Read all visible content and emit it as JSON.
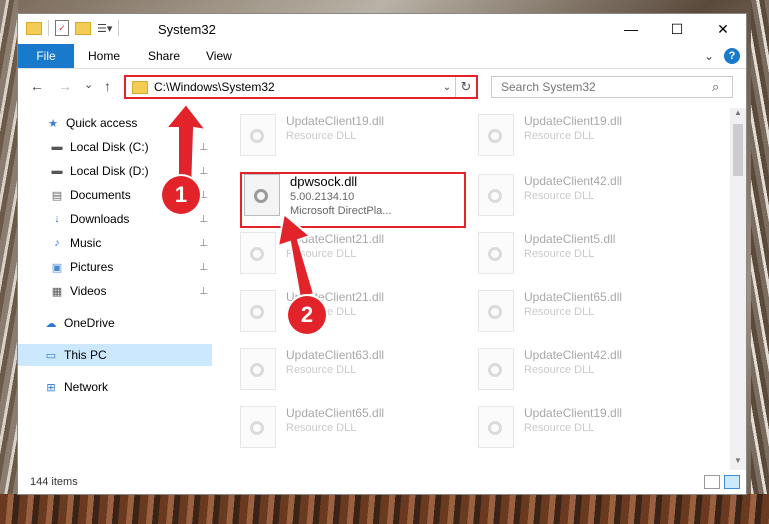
{
  "window": {
    "title": "System32",
    "controls": {
      "minimize": "—",
      "maximize": "☐",
      "close": "✕"
    }
  },
  "ribbon": {
    "tabs": [
      "File",
      "Home",
      "Share",
      "View"
    ],
    "expand_glyph": "⌄",
    "help_glyph": "?"
  },
  "nav": {
    "back": "←",
    "forward": "→",
    "recent": "⌄",
    "up": "↑",
    "address": "C:\\Windows\\System32",
    "dropdown": "⌄",
    "refresh": "↻",
    "search_placeholder": "Search System32",
    "search_glyph": "⌕"
  },
  "sidebar": {
    "items": [
      {
        "label": "Quick access",
        "icon": "star-icon",
        "glyph": "★",
        "color": "#3a7fd5"
      },
      {
        "label": "Local Disk (C:)",
        "icon": "drive-icon",
        "glyph": "▬",
        "pinned": true
      },
      {
        "label": "Local Disk (D:)",
        "icon": "drive-icon",
        "glyph": "▬",
        "pinned": true
      },
      {
        "label": "Documents",
        "icon": "documents-icon",
        "glyph": "▤",
        "pinned": true
      },
      {
        "label": "Downloads",
        "icon": "download-icon",
        "glyph": "↓",
        "color": "#2a7ad5",
        "pinned": true
      },
      {
        "label": "Music",
        "icon": "music-icon",
        "glyph": "♪",
        "color": "#2a7ad5",
        "pinned": true
      },
      {
        "label": "Pictures",
        "icon": "pictures-icon",
        "glyph": "▣",
        "pinned": true
      },
      {
        "label": "Videos",
        "icon": "video-icon",
        "glyph": "▦",
        "pinned": true
      },
      {
        "label": "OneDrive",
        "icon": "cloud-icon",
        "glyph": "☁",
        "color": "#2a7ad5"
      },
      {
        "label": "This PC",
        "icon": "computer-icon",
        "glyph": "▭",
        "selected": true
      },
      {
        "label": "Network",
        "icon": "network-icon",
        "glyph": "⊞",
        "color": "#2a7ad5"
      }
    ],
    "pin_glyph": "📌"
  },
  "files": {
    "highlighted": {
      "name": "dpwsock.dll",
      "version": "5.00.2134.10",
      "description": "Microsoft DirectPla..."
    },
    "faded": [
      {
        "name": "UpdateClient19.dll",
        "desc": "Resource DLL"
      },
      {
        "name": "UpdateClient19.dll",
        "desc": "Resource DLL"
      },
      {
        "name": "UpdateClient42.dll",
        "desc": "Resource DLL"
      },
      {
        "name": "UpdateClient21.dll",
        "desc": "Resource DLL"
      },
      {
        "name": "UpdateClient5.dll",
        "desc": "Resource DLL"
      },
      {
        "name": "UpdateClient21.dll",
        "desc": "Resource DLL"
      },
      {
        "name": "UpdateClient65.dll",
        "desc": "Resource DLL"
      },
      {
        "name": "UpdateClient63.dll",
        "desc": "Resource DLL"
      },
      {
        "name": "UpdateClient42.dll",
        "desc": "Resource DLL"
      },
      {
        "name": "UpdateClient65.dll",
        "desc": "Resource DLL"
      },
      {
        "name": "UpdateClient19.dll",
        "desc": "Resource DLL"
      }
    ]
  },
  "status": {
    "items_count": "144 items"
  },
  "callouts": {
    "one": "1",
    "two": "2",
    "color": "#e2232a"
  }
}
